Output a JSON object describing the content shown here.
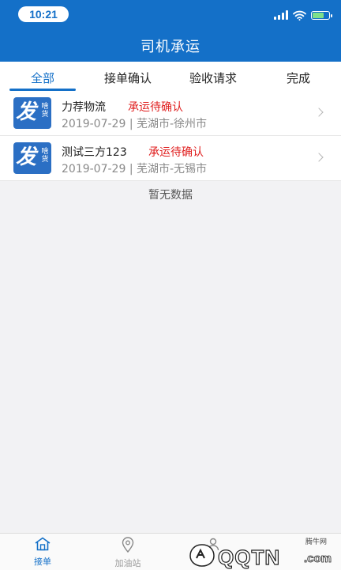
{
  "status_bar": {
    "time": "10:21"
  },
  "header": {
    "title": "司机承运"
  },
  "tabs": [
    {
      "label": "全部",
      "active": true
    },
    {
      "label": "接单确认",
      "active": false
    },
    {
      "label": "验收请求",
      "active": false
    },
    {
      "label": "完成",
      "active": false
    }
  ],
  "orders": [
    {
      "logo": {
        "big": "发",
        "small": "啥货"
      },
      "company": "力荐物流",
      "status": "承运待确认",
      "date": "2019-07-29",
      "separator": "|",
      "route": "芜湖市-徐州市"
    },
    {
      "logo": {
        "big": "发",
        "small": "啥货"
      },
      "company": "测试三方123",
      "status": "承运待确认",
      "date": "2019-07-29",
      "separator": "|",
      "route": "芜湖市-无锡市"
    }
  ],
  "empty_text": "暂无数据",
  "tabbar": {
    "items": [
      {
        "label": "接单",
        "icon": "home-icon",
        "active": true
      },
      {
        "label": "加油站",
        "icon": "location-pin-icon",
        "active": false
      },
      {
        "label": "",
        "icon": "user-icon",
        "active": false
      }
    ]
  },
  "watermark": {
    "small": "腾牛网",
    "text": "QQTN",
    "domain": ".com"
  },
  "colors": {
    "primary": "#1470c8",
    "status_red": "#e02020",
    "meta_gray": "#8a8a8a"
  }
}
